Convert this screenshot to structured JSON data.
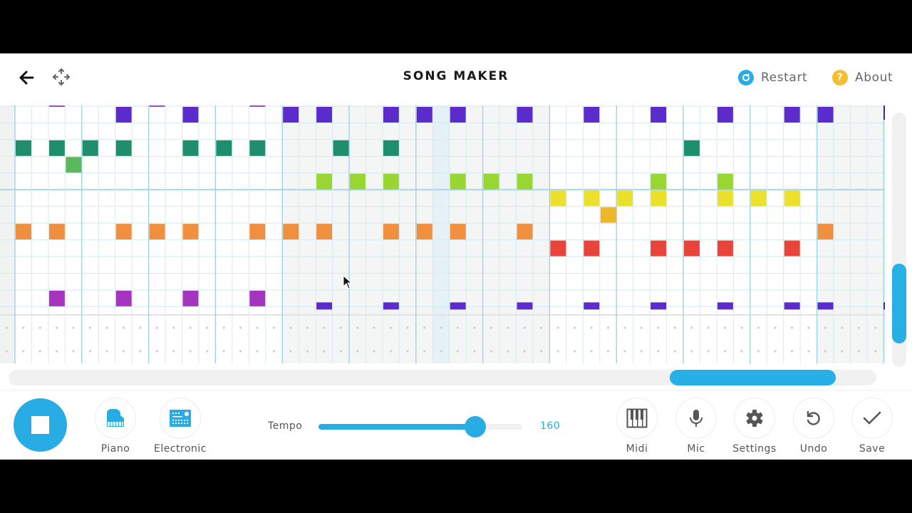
{
  "header": {
    "title": "SONG MAKER",
    "back_icon": "arrow-left-icon",
    "move_icon": "move-arrows-icon",
    "restart_label": "Restart",
    "restart_color": "#27ade4",
    "about_label": "About",
    "about_glyph": "?",
    "about_color": "#f6bd2e"
  },
  "grid": {
    "visible_columns": 53,
    "visible_rows": 12,
    "notes": [
      {
        "col": 6,
        "row": 0,
        "color": "#5b2bcc"
      },
      {
        "col": 10,
        "row": 0,
        "color": "#5b2bcc"
      },
      {
        "col": 16,
        "row": 0,
        "color": "#5b2bcc"
      },
      {
        "col": 18,
        "row": 0,
        "color": "#5b2bcc"
      },
      {
        "col": 22,
        "row": 0,
        "color": "#5b2bcc"
      },
      {
        "col": 24,
        "row": 0,
        "color": "#5b2bcc"
      },
      {
        "col": 26,
        "row": 0,
        "color": "#5b2bcc"
      },
      {
        "col": 30,
        "row": 0,
        "color": "#5b2bcc"
      },
      {
        "col": 34,
        "row": 0,
        "color": "#5b2bcc"
      },
      {
        "col": 38,
        "row": 0,
        "color": "#5b2bcc"
      },
      {
        "col": 42,
        "row": 0,
        "color": "#5b2bcc"
      },
      {
        "col": 46,
        "row": 0,
        "color": "#5b2bcc"
      },
      {
        "col": 48,
        "row": 0,
        "color": "#5b2bcc"
      },
      {
        "col": 0,
        "row": 2,
        "color": "#1e8e6c"
      },
      {
        "col": 2,
        "row": 2,
        "color": "#1e8e6c"
      },
      {
        "col": 4,
        "row": 2,
        "color": "#1e8e6c"
      },
      {
        "col": 6,
        "row": 2,
        "color": "#1e8e6c"
      },
      {
        "col": 10,
        "row": 2,
        "color": "#1e8e6c"
      },
      {
        "col": 12,
        "row": 2,
        "color": "#1e8e6c"
      },
      {
        "col": 14,
        "row": 2,
        "color": "#1e8e6c"
      },
      {
        "col": 19,
        "row": 2,
        "color": "#1e8e6c"
      },
      {
        "col": 22,
        "row": 2,
        "color": "#1e8e6c"
      },
      {
        "col": 40,
        "row": 2,
        "color": "#1e8e6c"
      },
      {
        "col": 3,
        "row": 3,
        "color": "#5cb85c"
      },
      {
        "col": 18,
        "row": 4,
        "color": "#9ad631"
      },
      {
        "col": 20,
        "row": 4,
        "color": "#9ad631"
      },
      {
        "col": 22,
        "row": 4,
        "color": "#9ad631"
      },
      {
        "col": 26,
        "row": 4,
        "color": "#9ad631"
      },
      {
        "col": 28,
        "row": 4,
        "color": "#9ad631"
      },
      {
        "col": 30,
        "row": 4,
        "color": "#9ad631"
      },
      {
        "col": 38,
        "row": 4,
        "color": "#9ad631"
      },
      {
        "col": 42,
        "row": 4,
        "color": "#9ad631"
      },
      {
        "col": 32,
        "row": 5,
        "color": "#ebe12c"
      },
      {
        "col": 34,
        "row": 5,
        "color": "#ebe12c"
      },
      {
        "col": 36,
        "row": 5,
        "color": "#ebe12c"
      },
      {
        "col": 38,
        "row": 5,
        "color": "#ebe12c"
      },
      {
        "col": 42,
        "row": 5,
        "color": "#ebe12c"
      },
      {
        "col": 44,
        "row": 5,
        "color": "#ebe12c"
      },
      {
        "col": 46,
        "row": 5,
        "color": "#ebe12c"
      },
      {
        "col": 35,
        "row": 6,
        "color": "#efb62c"
      },
      {
        "col": 0,
        "row": 7,
        "color": "#f08f3e"
      },
      {
        "col": 2,
        "row": 7,
        "color": "#f08f3e"
      },
      {
        "col": 6,
        "row": 7,
        "color": "#f08f3e"
      },
      {
        "col": 8,
        "row": 7,
        "color": "#f08f3e"
      },
      {
        "col": 10,
        "row": 7,
        "color": "#f08f3e"
      },
      {
        "col": 14,
        "row": 7,
        "color": "#f08f3e"
      },
      {
        "col": 16,
        "row": 7,
        "color": "#f08f3e"
      },
      {
        "col": 18,
        "row": 7,
        "color": "#f08f3e"
      },
      {
        "col": 22,
        "row": 7,
        "color": "#f08f3e"
      },
      {
        "col": 24,
        "row": 7,
        "color": "#f08f3e"
      },
      {
        "col": 26,
        "row": 7,
        "color": "#f08f3e"
      },
      {
        "col": 30,
        "row": 7,
        "color": "#f08f3e"
      },
      {
        "col": 48,
        "row": 7,
        "color": "#f08f3e"
      },
      {
        "col": 32,
        "row": 8,
        "color": "#e8443a"
      },
      {
        "col": 34,
        "row": 8,
        "color": "#e8443a"
      },
      {
        "col": 38,
        "row": 8,
        "color": "#e8443a"
      },
      {
        "col": 40,
        "row": 8,
        "color": "#e8443a"
      },
      {
        "col": 42,
        "row": 8,
        "color": "#e8443a"
      },
      {
        "col": 46,
        "row": 8,
        "color": "#e8443a"
      },
      {
        "col": 2,
        "row": 11,
        "color": "#a535c0"
      },
      {
        "col": 6,
        "row": 11,
        "color": "#a535c0"
      },
      {
        "col": 10,
        "row": 11,
        "color": "#a535c0"
      },
      {
        "col": 14,
        "row": 11,
        "color": "#a535c0"
      }
    ],
    "bottom_partial_notes": [
      18,
      22,
      26,
      30,
      34,
      38,
      42,
      46,
      48
    ],
    "top_partial_notes": [
      2,
      8,
      14
    ],
    "highlight_column": 25
  },
  "scroll": {
    "vertical_position_fraction": 0.6,
    "horizontal_position_fraction": 0.76
  },
  "footer": {
    "play_state": "playing",
    "stop_icon": "stop-icon",
    "instruments": [
      {
        "label": "Piano",
        "icon": "piano-icon"
      },
      {
        "label": "Electronic",
        "icon": "electronic-icon"
      }
    ],
    "tempo_label": "Tempo",
    "tempo_value": "160",
    "tempo_fraction": 0.77,
    "tools": [
      {
        "label": "Midi",
        "icon": "midi-keyboard-icon"
      },
      {
        "label": "Mic",
        "icon": "mic-icon"
      },
      {
        "label": "Settings",
        "icon": "gear-icon"
      },
      {
        "label": "Undo",
        "icon": "undo-icon"
      },
      {
        "label": "Save",
        "icon": "checkmark-icon"
      }
    ],
    "accent_color": "#27ade4"
  }
}
